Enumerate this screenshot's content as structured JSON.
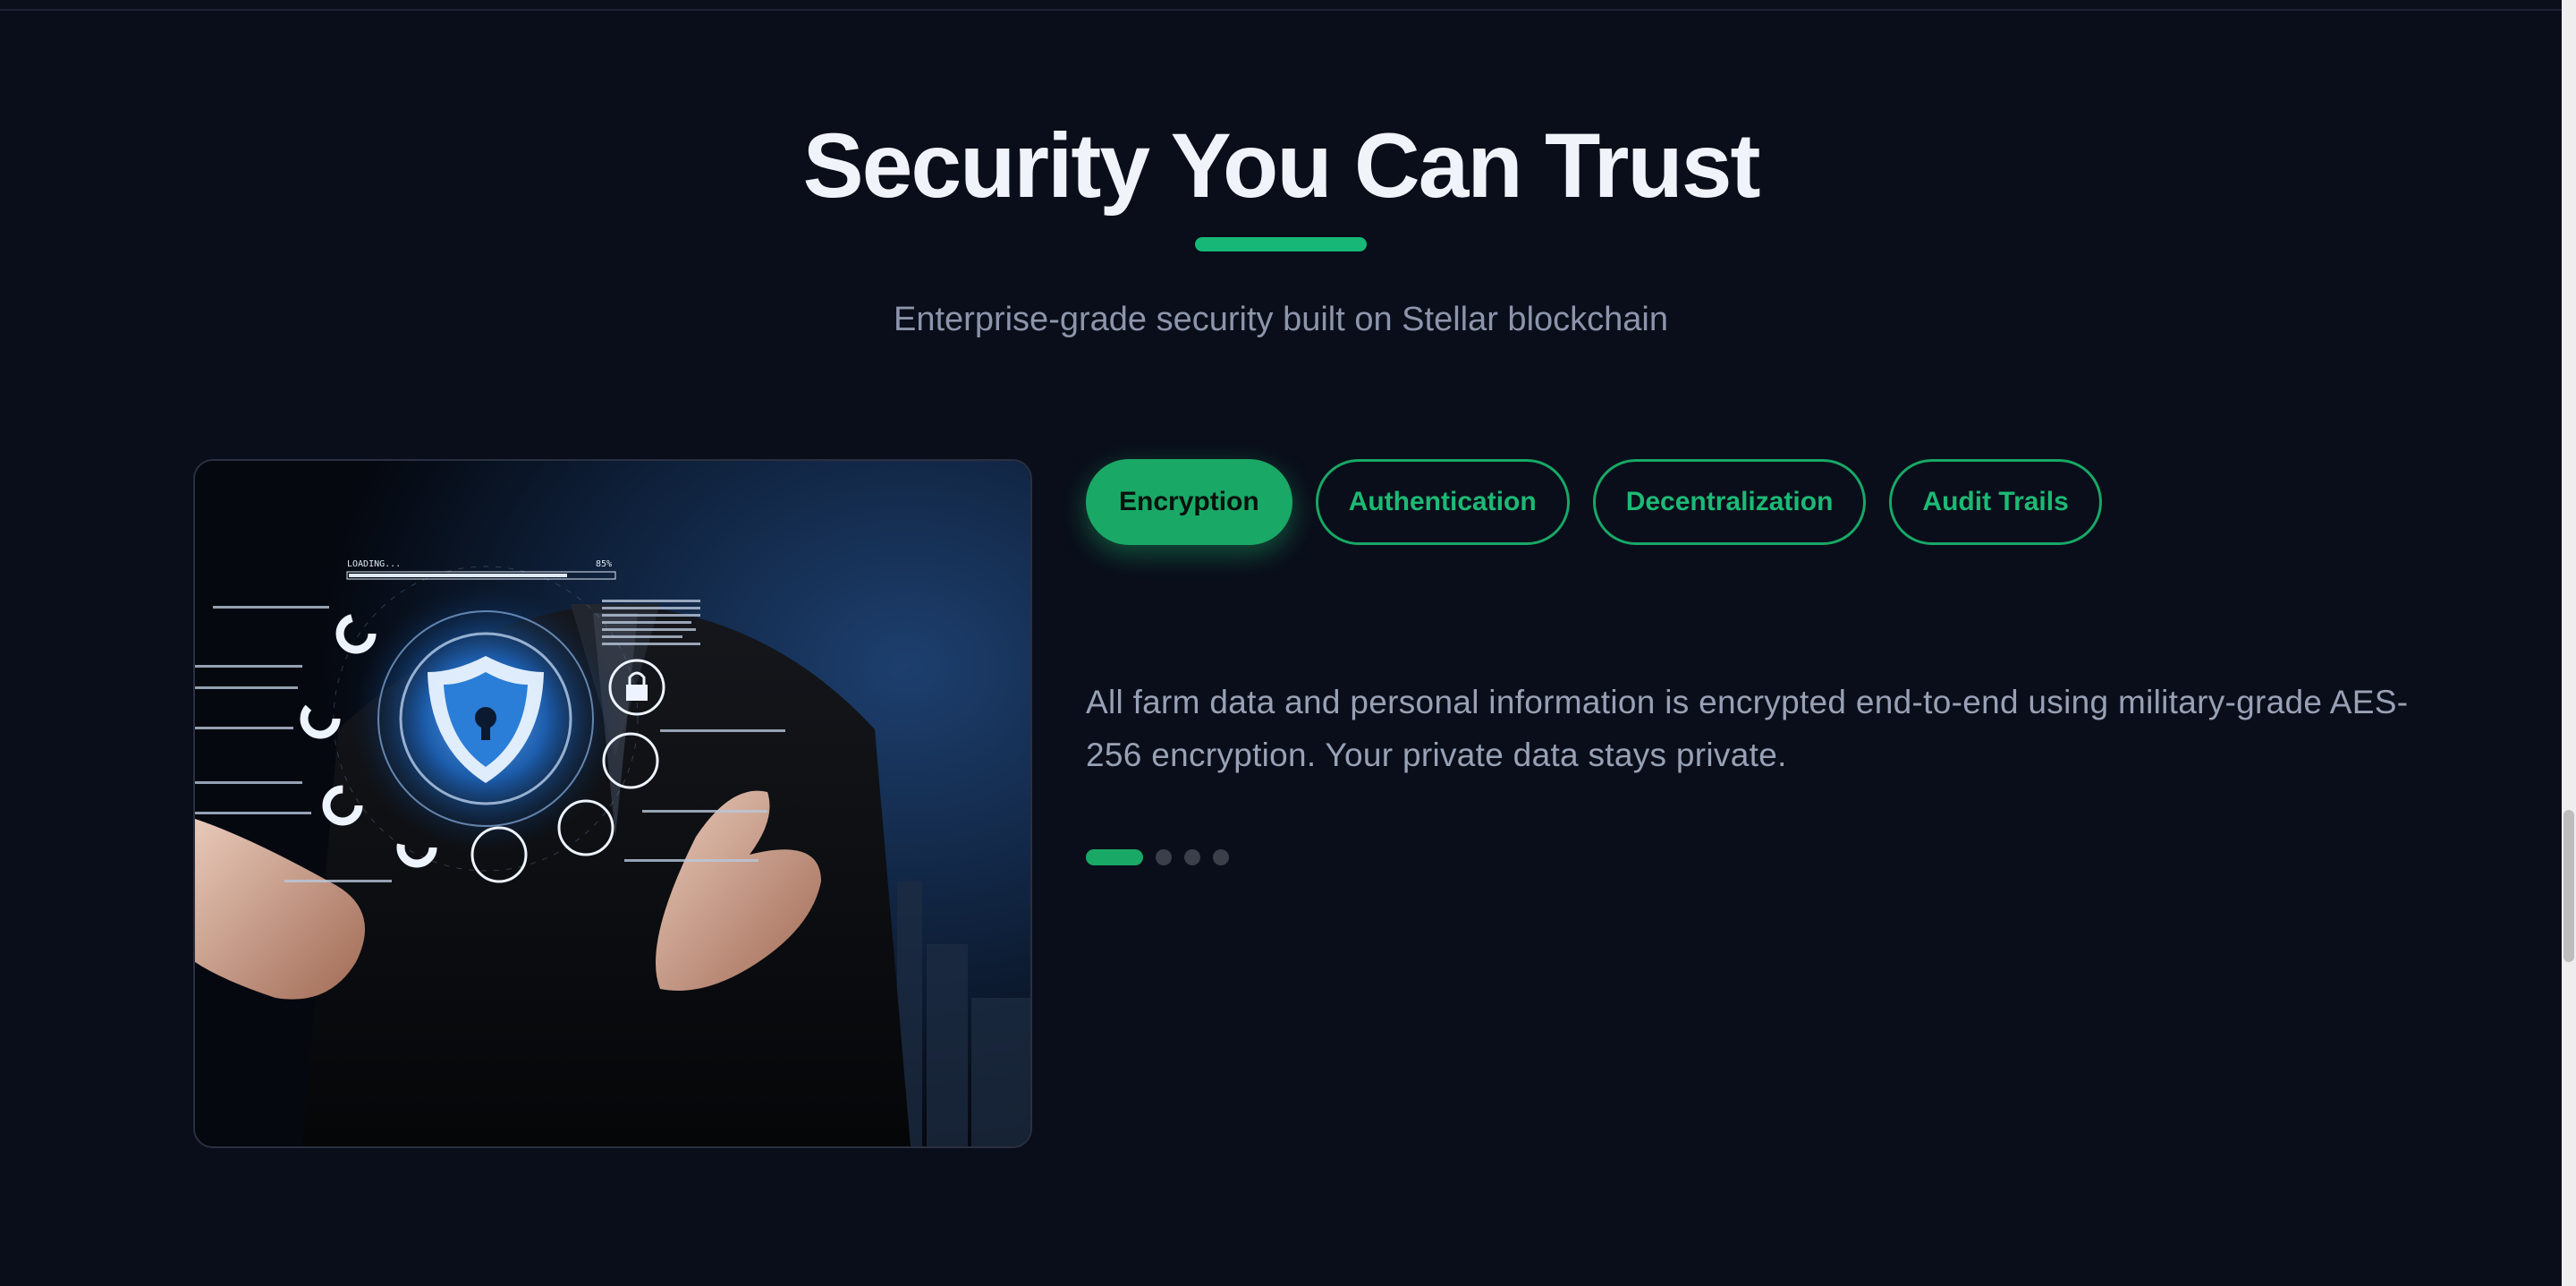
{
  "section": {
    "title": "Security You Can Trust",
    "subtitle": "Enterprise-grade security built on Stellar blockchain"
  },
  "image": {
    "label": "Cybersecurity shield illustration",
    "hud_loading": "LOADING...",
    "hud_percent": "85%"
  },
  "tabs": [
    {
      "label": "Encryption",
      "active": true
    },
    {
      "label": "Authentication",
      "active": false
    },
    {
      "label": "Decentralization",
      "active": false
    },
    {
      "label": "Audit Trails",
      "active": false
    }
  ],
  "content": {
    "description": "All farm data and personal information is encrypted end-to-end using military-grade AES-256 encryption. Your private data stays private."
  },
  "carousel": {
    "total": 4,
    "active_index": 0
  },
  "colors": {
    "background": "#0a0e1a",
    "accent": "#1aa866",
    "heading": "#f1f3fa",
    "muted_text": "#98a1b5"
  }
}
